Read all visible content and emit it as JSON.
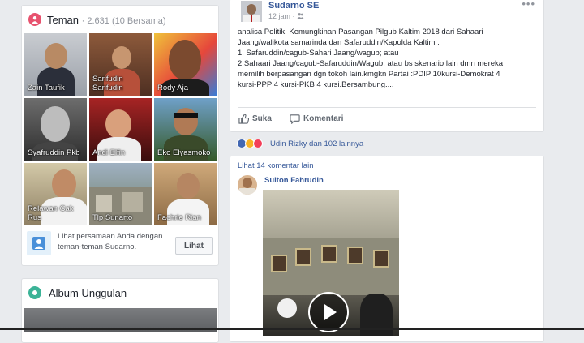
{
  "friends": {
    "title": "Teman",
    "count": "· 2.631 (10 Bersama)",
    "tiles": [
      {
        "name": "Zain Taufik"
      },
      {
        "name": "Sarifudin Sarifudin"
      },
      {
        "name": "Rody Aja"
      },
      {
        "name": "Syafruddin Pkb"
      },
      {
        "name": "Andi Elfin"
      },
      {
        "name": "Eko Elyasmoko"
      },
      {
        "name": "Relawan Cak Rus"
      },
      {
        "name": "Tlp Sunarto"
      },
      {
        "name": "Fachrie Rian"
      }
    ],
    "similarity_text": "Lihat persamaan Anda dengan teman-teman Sudarno.",
    "similarity_button": "Lihat"
  },
  "album": {
    "title": "Album Unggulan"
  },
  "post": {
    "author": "Sudarno SE",
    "time": "12 jam ·",
    "more": "•••",
    "lines": [
      "analisa Politik: Kemungkinan Pasangan Pilgub Kaltim 2018 dari Sahaari",
      "Jaang/walikota samarinda dan Safaruddin/Kapolda Kaltim :",
      "1. Safaruddin/cagub-Sahari Jaang/wagub; atau",
      "2.Sahaari Jaang/cagub-Safaruddin/Wagub; atau bs skenario lain dmn mereka",
      "memilih berpasangan dgn tokoh lain.kmgkn Partai :PDIP 10kursi-Demokrat 4",
      "kursi-PPP 4 kursi-PKB 4 kursi.Bersambung...."
    ],
    "like_label": "Suka",
    "comment_label": "Komentari"
  },
  "reactions": {
    "text": "Udin Rizky dan 102 lainnya",
    "colors": [
      "#4267b2",
      "#f7b125",
      "#f33e58"
    ]
  },
  "comments": {
    "more_label": "Lihat 14 komentar lain",
    "commenter": "Sulton Fahrudin"
  }
}
